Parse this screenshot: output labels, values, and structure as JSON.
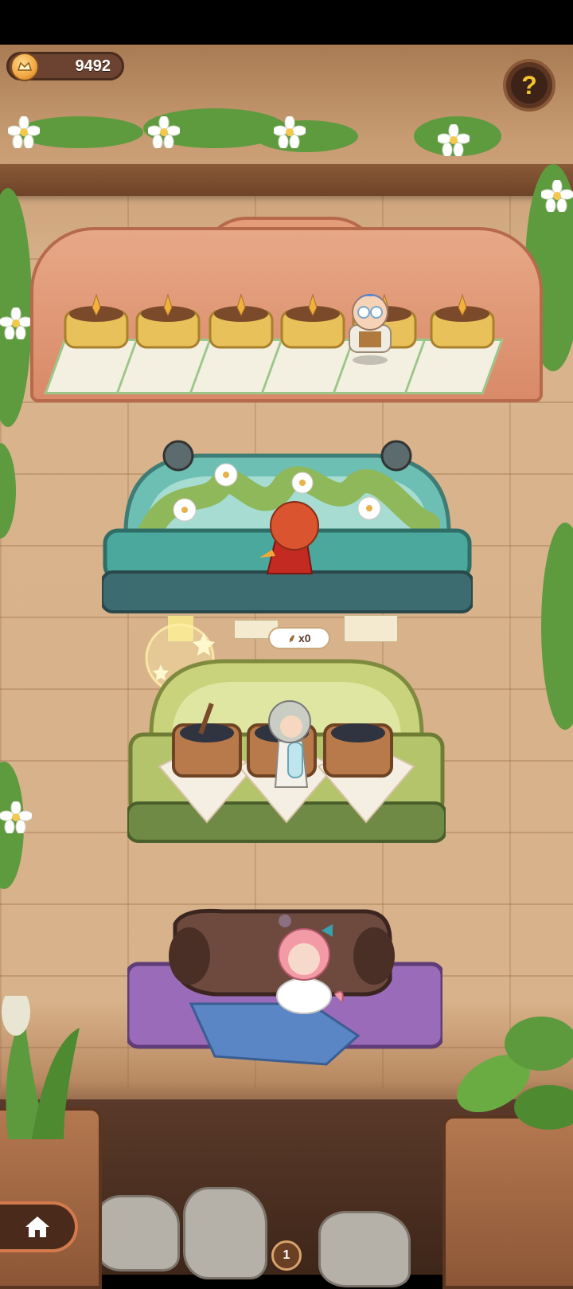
{
  "hud": {
    "currency_value": "9492",
    "currency_icon": "gold-coin-icon",
    "help_icon": "question-mark-icon",
    "help_glyph": "?"
  },
  "stations": {
    "counter_bubble_text": "x0"
  },
  "nav": {
    "home_icon": "home-icon",
    "page_number": "1"
  },
  "colors": {
    "shelf1": "#e7a887",
    "shelf2": "#5fb0a4",
    "shelf3": "#b4c46a",
    "shelf4": "#9a6bb8",
    "accent": "#f4c431"
  }
}
